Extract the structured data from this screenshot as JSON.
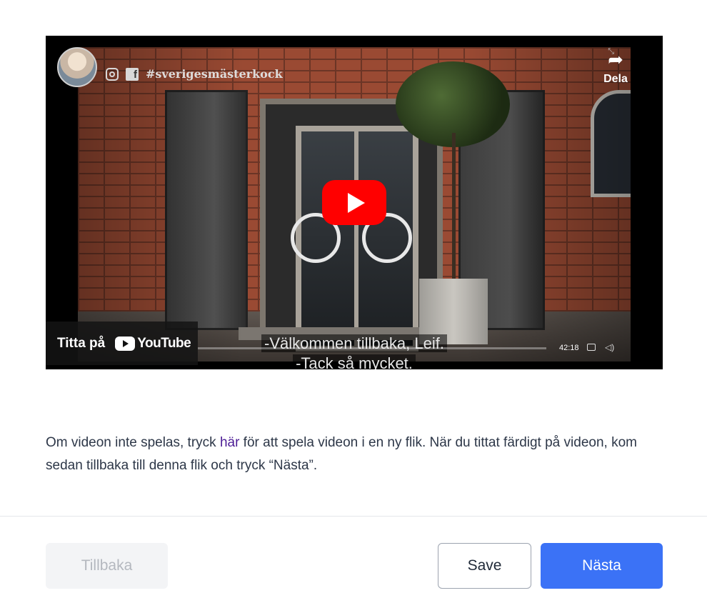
{
  "video": {
    "channel_hashtag": "#sverigesmästerkock",
    "share_label": "Dela",
    "subtitle_line1": "-Välkommen tillbaka, Leif.",
    "subtitle_line2": "-Tack så mycket.",
    "watch_on_label": "Titta på",
    "youtube_brand": "YouTube",
    "duration": "42:18"
  },
  "instructions": {
    "before_link": "Om videon inte spelas, tryck ",
    "link_text": "här",
    "after_link": " för att spela videon i en ny flik. När du tittat färdigt på videon, kom sedan tillbaka till denna flik och tryck “Nästa”."
  },
  "footer": {
    "back_label": "Tillbaka",
    "save_label": "Save",
    "next_label": "Nästa"
  },
  "colors": {
    "primary": "#3b72f6",
    "link": "#4c1d95",
    "youtube_red": "#ff0000"
  }
}
